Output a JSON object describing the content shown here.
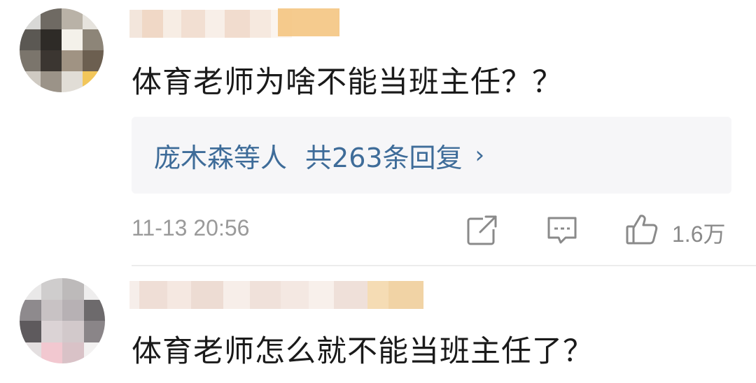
{
  "comments": [
    {
      "text": "体育老师为啥不能当班主任？？",
      "reply_preview": {
        "who": "庞木森等人",
        "count_label": "共263条回复",
        "arrow": "›"
      },
      "timestamp": "11-13 20:56",
      "like_count": "1.6万",
      "icons": {
        "share": "share-icon",
        "comment": "comment-icon",
        "like": "thumbs-up-icon"
      }
    },
    {
      "text": "体育老师怎么就不能当班主任了？"
    }
  ],
  "colors": {
    "link_blue": "#3e6c99",
    "meta_gray": "#9a9a9a",
    "reply_bg": "#f6f6f8",
    "badge_gold": "#f3c27a"
  }
}
